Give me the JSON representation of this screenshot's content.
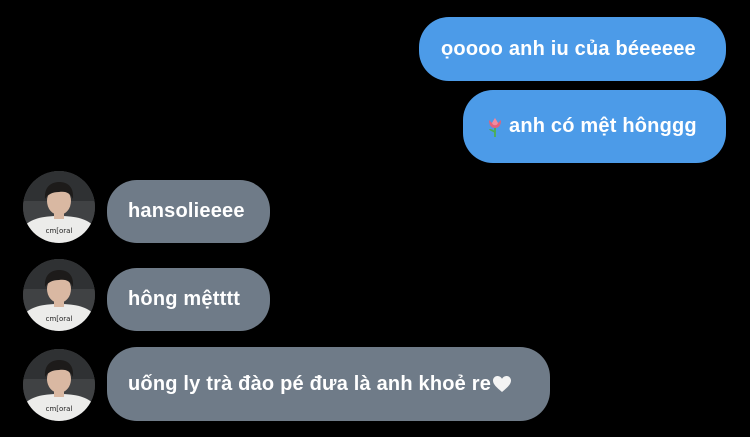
{
  "messages": {
    "sent": [
      {
        "text": "ọoooo anh iu của béeeeee"
      },
      {
        "emoji": "tulip-icon",
        "text": "anh có mệt hônggg"
      }
    ],
    "received": [
      {
        "text": "hansolieeee"
      },
      {
        "text": "hông mệtttt"
      },
      {
        "text": "uống ly trà đào pé đưa là anh khoẻ re",
        "emoji": "white-heart-icon"
      }
    ]
  },
  "avatar": {
    "shirt_text": "cm[oral"
  },
  "colors": {
    "background": "#000000",
    "sent_bubble": "#4c9be8",
    "received_bubble": "#6f7b88",
    "text": "#ffffff"
  }
}
